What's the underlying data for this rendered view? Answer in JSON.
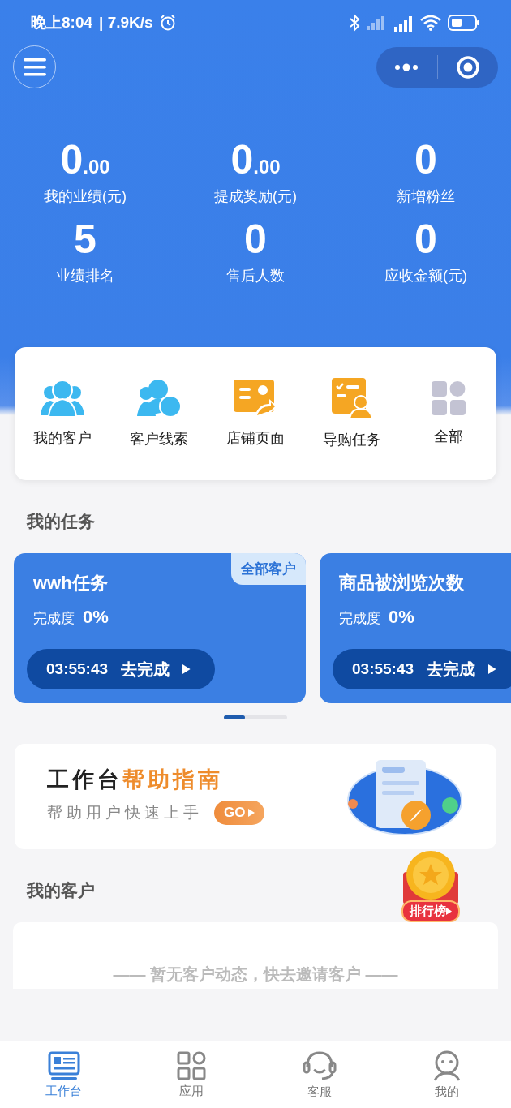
{
  "status_bar": {
    "time": "晚上8:04",
    "speed": "| 7.9K/s"
  },
  "stats": [
    {
      "value": "0",
      "decimal": ".00",
      "label": "我的业绩(元)"
    },
    {
      "value": "0",
      "decimal": ".00",
      "label": "提成奖励(元)"
    },
    {
      "value": "0",
      "label": "新增粉丝"
    },
    {
      "value": "5",
      "label": "业绩排名"
    },
    {
      "value": "0",
      "label": "售后人数"
    },
    {
      "value": "0",
      "label": "应收金额(元)"
    }
  ],
  "shortcuts": [
    {
      "kind": "customers",
      "label": "我的客户"
    },
    {
      "kind": "leads",
      "label": "客户线索"
    },
    {
      "kind": "store",
      "label": "店铺页面"
    },
    {
      "kind": "task",
      "label": "导购任务"
    },
    {
      "kind": "all",
      "label": "全部"
    }
  ],
  "tasks_section": {
    "title": "我的任务"
  },
  "tasks": [
    {
      "title": "wwh任务",
      "tag": "全部客户",
      "progress_label": "完成度",
      "progress": "0%",
      "countdown": "03:55:43",
      "action": "去完成"
    },
    {
      "title": "商品被浏览次数",
      "progress_label": "完成度",
      "progress": "0%",
      "countdown": "03:55:43",
      "action": "去完成"
    }
  ],
  "help_banner": {
    "title": "工作台",
    "highlight": "帮助指南",
    "subtitle": "帮助用户快速上手",
    "button": "GO"
  },
  "leaderboard_badge": {
    "label": "排行榜"
  },
  "customers_section": {
    "title": "我的客户",
    "empty": "—— 暂无客户动态，快去邀请客户 ——"
  },
  "tabs": [
    {
      "kind": "workbench",
      "label": "工作台",
      "selected": true
    },
    {
      "kind": "apps",
      "label": "应用",
      "selected": false
    },
    {
      "kind": "service",
      "label": "客服",
      "selected": false
    },
    {
      "kind": "profile",
      "label": "我的",
      "selected": false
    }
  ]
}
